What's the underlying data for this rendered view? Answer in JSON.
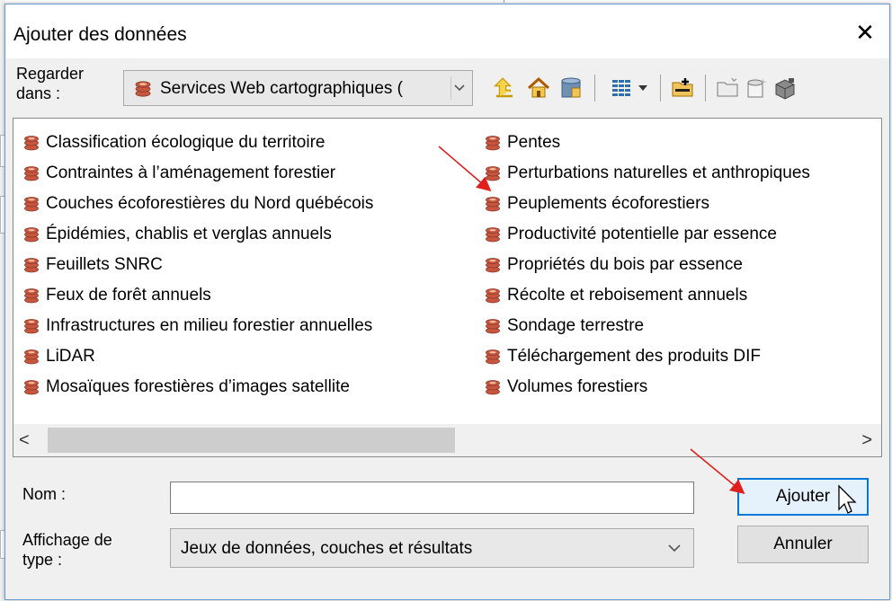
{
  "dialog": {
    "title": "Ajouter des données",
    "close_glyph": "✕"
  },
  "lookin": {
    "label_line1": "Regarder",
    "label_line2": "dans :",
    "value": "Services Web cartographiques (",
    "dropdown_icon": "chevron-down-icon"
  },
  "toolbar": {
    "icons": [
      "up-one-level-icon",
      "home-icon",
      "geodatabase-icon",
      "view-icon",
      "connect-folder-icon",
      "new-folder-icon",
      "new-shapefile-icon",
      "toolbox-icon"
    ]
  },
  "list": {
    "column1": [
      "Classification écologique du territoire",
      "Contraintes à l’aménagement forestier",
      "Couches écoforestières du Nord québécois",
      "Épidémies, chablis et verglas annuels",
      "Feuillets SNRC",
      "Feux de forêt annuels",
      "Infrastructures en milieu forestier annuelles",
      "LiDAR",
      "Mosaïques forestières d’images satellite"
    ],
    "column2": [
      "Pentes",
      "Perturbations naturelles et anthropiques",
      "Peuplements écoforestiers",
      "Productivité potentielle par essence",
      "Propriétés du bois par essence",
      "Récolte et reboisement annuels",
      "Sondage terrestre",
      "Téléchargement des produits DIF",
      "Volumes forestiers"
    ],
    "scroll_left": "<",
    "scroll_right": ">"
  },
  "form": {
    "name_label": "Nom :",
    "name_value": "",
    "type_label_line1": "Affichage de",
    "type_label_line2": "type :",
    "type_value": "Jeux de données, couches et résultats"
  },
  "buttons": {
    "add": "Ajouter",
    "cancel": "Annuler"
  },
  "colors": {
    "accent": "#0078d7",
    "annotation_arrow": "#e0201c",
    "layer_icon": "#c8553d"
  }
}
